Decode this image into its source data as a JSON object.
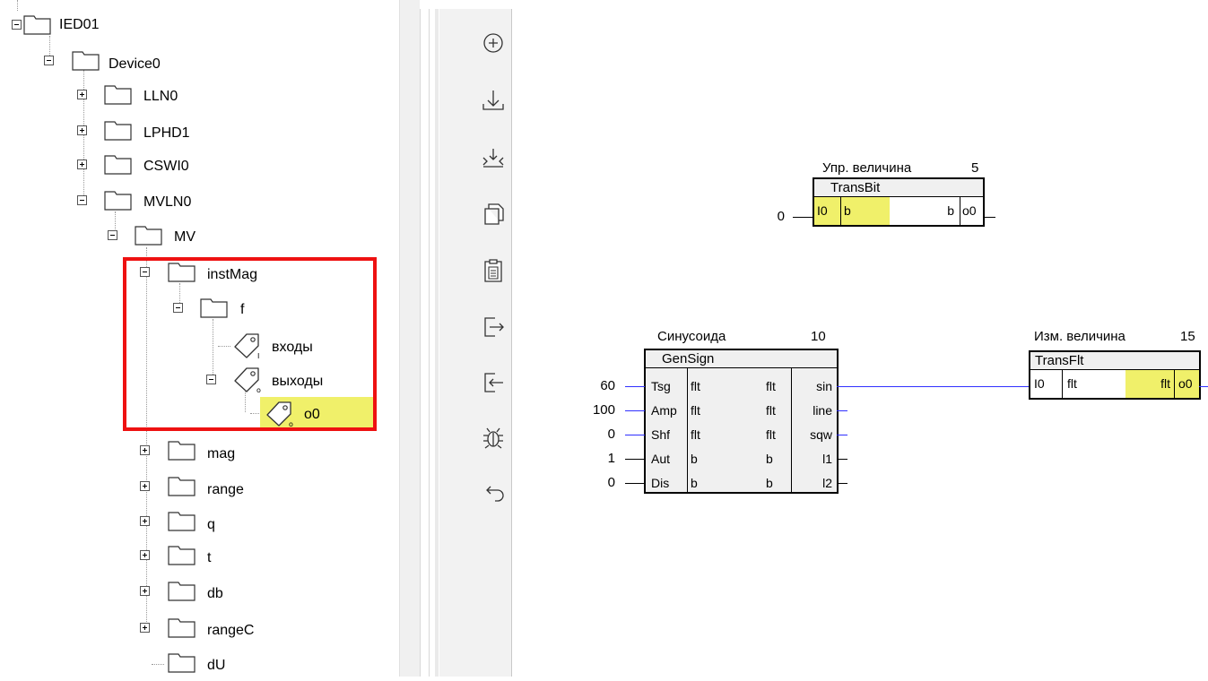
{
  "tree": {
    "nodes": [
      {
        "label": "IED01",
        "expanded": true,
        "icon": "folder-icon"
      },
      {
        "label": "Device0",
        "expanded": true,
        "icon": "folder-icon"
      },
      {
        "label": "LLN0",
        "expanded": false,
        "icon": "folder-icon"
      },
      {
        "label": "LPHD1",
        "expanded": false,
        "icon": "folder-icon"
      },
      {
        "label": "CSWI0",
        "expanded": false,
        "icon": "folder-icon"
      },
      {
        "label": "MVLN0",
        "expanded": true,
        "icon": "folder-icon"
      },
      {
        "label": "MV",
        "expanded": true,
        "icon": "folder-icon"
      },
      {
        "label": "instMag",
        "expanded": true,
        "icon": "folder-icon"
      },
      {
        "label": "f",
        "expanded": true,
        "icon": "folder-icon"
      },
      {
        "label": "входы",
        "icon": "tag-icon"
      },
      {
        "label": "выходы",
        "expanded": true,
        "icon": "tag-icon"
      },
      {
        "label": "o0",
        "icon": "tag-icon",
        "selected": true
      },
      {
        "label": "mag",
        "expanded": false,
        "icon": "folder-icon"
      },
      {
        "label": "range",
        "expanded": false,
        "icon": "folder-icon"
      },
      {
        "label": "q",
        "expanded": false,
        "icon": "folder-icon"
      },
      {
        "label": "t",
        "expanded": false,
        "icon": "folder-icon"
      },
      {
        "label": "db",
        "expanded": false,
        "icon": "folder-icon"
      },
      {
        "label": "rangeC",
        "expanded": false,
        "icon": "folder-icon"
      },
      {
        "label": "dU",
        "icon": "folder-icon"
      }
    ]
  },
  "toolbar": {
    "buttons": [
      "add-icon",
      "download-icon",
      "import-icon",
      "copy-icon",
      "paste-icon",
      "export-icon",
      "import-arrow-icon",
      "debug-icon",
      "undo-icon"
    ]
  },
  "canvas": {
    "transbit": {
      "title": "Упр. величина",
      "number": "5",
      "type": "TransBit",
      "input_value": "0",
      "in_pin": "I0",
      "in_type": "b",
      "out_type": "b",
      "out_pin": "o0"
    },
    "gensign": {
      "title": "Синусоида",
      "number": "10",
      "type": "GenSign",
      "rows": [
        {
          "value": "60",
          "in_pin": "Tsg",
          "in_type": "flt",
          "out_type": "flt",
          "out_pin": "sin"
        },
        {
          "value": "100",
          "in_pin": "Amp",
          "in_type": "flt",
          "out_type": "flt",
          "out_pin": "line"
        },
        {
          "value": "0",
          "in_pin": "Shf",
          "in_type": "flt",
          "out_type": "flt",
          "out_pin": "sqw"
        },
        {
          "value": "1",
          "in_pin": "Aut",
          "in_type": "b",
          "out_type": "b",
          "out_pin": "l1"
        },
        {
          "value": "0",
          "in_pin": "Dis",
          "in_type": "b",
          "out_type": "b",
          "out_pin": "l2"
        }
      ]
    },
    "transflt": {
      "title": "Изм. величина",
      "number": "15",
      "type": "TransFlt",
      "in_pin": "I0",
      "in_type": "flt",
      "out_type": "flt",
      "out_pin": "o0"
    }
  },
  "colors": {
    "highlight": "#f0f06a",
    "selection_border": "#ee1111",
    "wire": "#3030ff"
  }
}
